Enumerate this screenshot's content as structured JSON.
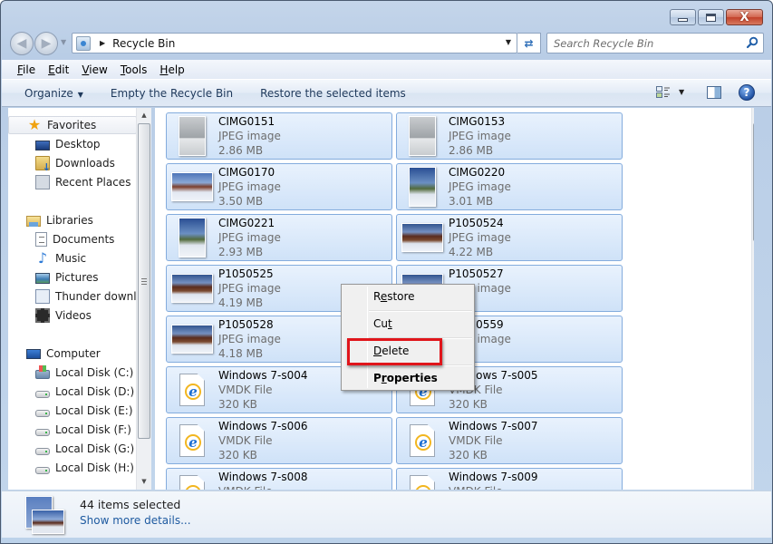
{
  "window": {
    "title": "Recycle Bin",
    "caption_buttons": [
      {
        "name": "minimize",
        "icon": "minimize-icon"
      },
      {
        "name": "maximize",
        "icon": "maximize-icon"
      },
      {
        "name": "close",
        "icon": "close-icon",
        "glyph": "X"
      }
    ]
  },
  "navigation": {
    "back_icon": "back-arrow-icon",
    "forward_icon": "forward-arrow-icon",
    "recent_pages_icon": "chevron-down-icon",
    "address": {
      "icon": "recycle-bin-icon",
      "separator_icon": "breadcrumb-arrow-icon",
      "path": "Recycle Bin",
      "dropdown_icon": "chevron-down-icon"
    },
    "refresh_icon": "refresh-icon",
    "search": {
      "placeholder": "Search Recycle Bin",
      "value": "",
      "icon": "search-icon"
    }
  },
  "menubar": {
    "items": [
      {
        "accel": "F",
        "rest": "ile"
      },
      {
        "accel": "E",
        "rest": "dit"
      },
      {
        "accel": "V",
        "rest": "iew"
      },
      {
        "accel": "T",
        "rest": "ools"
      },
      {
        "accel": "H",
        "rest": "elp"
      }
    ]
  },
  "toolbar": {
    "organize_label": "Organize",
    "organize_arrow": "▼",
    "empty_label": "Empty the Recycle Bin",
    "restore_label": "Restore the selected items",
    "views_arrow": "▼",
    "help_glyph": "?"
  },
  "sidebar": {
    "favorites": {
      "label": "Favorites",
      "items": [
        {
          "label": "Desktop",
          "icon": "desktop-icon"
        },
        {
          "label": "Downloads",
          "icon": "downloads-icon"
        },
        {
          "label": "Recent Places",
          "icon": "recent-places-icon"
        }
      ]
    },
    "libraries": {
      "label": "Libraries",
      "items": [
        {
          "label": "Documents",
          "icon": "documents-icon"
        },
        {
          "label": "Music",
          "icon": "music-icon"
        },
        {
          "label": "Pictures",
          "icon": "pictures-icon"
        },
        {
          "label": "Thunder downlo",
          "icon": "thunder-download-icon"
        },
        {
          "label": "Videos",
          "icon": "videos-icon"
        }
      ]
    },
    "computer": {
      "label": "Computer",
      "items": [
        {
          "label": "Local Disk (C:)",
          "icon": "system-disk-icon"
        },
        {
          "label": "Local Disk (D:)",
          "icon": "disk-icon"
        },
        {
          "label": "Local Disk (E:)",
          "icon": "disk-icon"
        },
        {
          "label": "Local Disk (F:)",
          "icon": "disk-icon"
        },
        {
          "label": "Local Disk (G:)",
          "icon": "disk-icon"
        },
        {
          "label": "Local Disk (H:)",
          "icon": "disk-icon"
        }
      ]
    }
  },
  "files": [
    {
      "name": "CIMG0151",
      "type": "JPEG image",
      "size": "2.86 MB",
      "thumb": "portrait gray"
    },
    {
      "name": "CIMG0153",
      "type": "JPEG image",
      "size": "2.86 MB",
      "thumb": "portrait gray"
    },
    {
      "name": "CIMG0170",
      "type": "JPEG image",
      "size": "3.50 MB",
      "thumb": "landscape people"
    },
    {
      "name": "CIMG0220",
      "type": "JPEG image",
      "size": "3.01 MB",
      "thumb": "portrait snow"
    },
    {
      "name": "CIMG0221",
      "type": "JPEG image",
      "size": "2.93 MB",
      "thumb": "portrait snow"
    },
    {
      "name": "P1050524",
      "type": "JPEG image",
      "size": "4.22 MB",
      "thumb": "landscape temple"
    },
    {
      "name": "P1050525",
      "type": "JPEG image",
      "size": "4.19 MB",
      "thumb": "landscape temple"
    },
    {
      "name": "P1050527",
      "type": "JPEG image",
      "size": "",
      "thumb": "landscape temple"
    },
    {
      "name": "P1050528",
      "type": "JPEG image",
      "size": "4.18 MB",
      "thumb": "landscape temple"
    },
    {
      "name": "P1050559",
      "type": "JPEG image",
      "size": "",
      "thumb": "landscape temple"
    },
    {
      "name": "Windows 7-s004",
      "type": "VMDK File",
      "size": "320 KB",
      "thumb": "vmdk"
    },
    {
      "name": "Windows 7-s005",
      "type": "VMDK File",
      "size": "320 KB",
      "thumb": "vmdk"
    },
    {
      "name": "Windows 7-s006",
      "type": "VMDK File",
      "size": "320 KB",
      "thumb": "vmdk"
    },
    {
      "name": "Windows 7-s007",
      "type": "VMDK File",
      "size": "320 KB",
      "thumb": "vmdk"
    },
    {
      "name": "Windows 7-s008",
      "type": "VMDK File",
      "size": "",
      "thumb": "vmdk"
    },
    {
      "name": "Windows 7-s009",
      "type": "VMDK File",
      "size": "",
      "thumb": "vmdk"
    }
  ],
  "context_menu": {
    "items": [
      {
        "id": "restore",
        "before": "R",
        "accel": "e",
        "after": "store",
        "bold": false
      },
      {
        "id": "cut",
        "before": "Cu",
        "accel": "t",
        "after": "",
        "bold": false
      },
      {
        "id": "delete",
        "before": "",
        "accel": "D",
        "after": "elete",
        "bold": false,
        "highlighted": true
      },
      {
        "id": "properties",
        "before": "P",
        "accel": "r",
        "after": "operties",
        "bold": true
      }
    ],
    "highlight_color": "#e0151b"
  },
  "details_pane": {
    "count_text": "44 items selected",
    "link_text": "Show more details..."
  }
}
